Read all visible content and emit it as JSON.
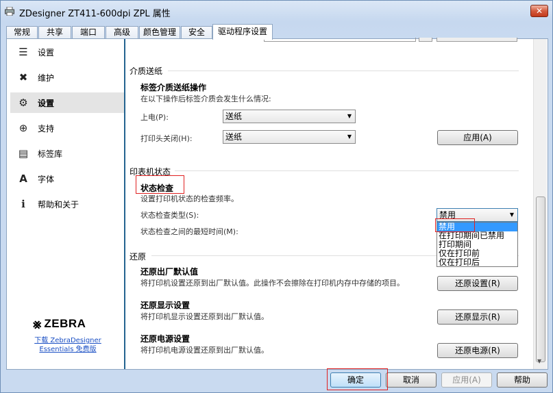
{
  "window": {
    "title": "ZDesigner ZT411-600dpi ZPL 属性",
    "close_glyph": "✕"
  },
  "tabs": [
    {
      "label": "常规"
    },
    {
      "label": "共享"
    },
    {
      "label": "端口"
    },
    {
      "label": "高级"
    },
    {
      "label": "颜色管理"
    },
    {
      "label": "安全"
    },
    {
      "label": "驱动程序设置"
    }
  ],
  "sidebar": {
    "items": [
      {
        "label": "设置",
        "icon": "sliders-icon",
        "glyph": "☰"
      },
      {
        "label": "维护",
        "icon": "tools-icon",
        "glyph": "✖"
      },
      {
        "label": "设置",
        "icon": "gear-icon",
        "glyph": "⚙"
      },
      {
        "label": "支持",
        "icon": "lifebuoy-icon",
        "glyph": "⊕"
      },
      {
        "label": "标签库",
        "icon": "label-icon",
        "glyph": "▤"
      },
      {
        "label": "字体",
        "icon": "font-icon",
        "glyph": "A"
      },
      {
        "label": "帮助和关于",
        "icon": "info-icon",
        "glyph": "ℹ"
      }
    ],
    "brand": {
      "logo_text": "ZEBRA",
      "logo_glyph": "⨳",
      "link_line1": "下载 ZebraDesigner",
      "link_line2": "Essentials 免费版"
    }
  },
  "media_feed": {
    "section_title": "介质送纸",
    "subtitle": "标签介质送纸操作",
    "description": "在以下操作后标签介质会发生什么情况:",
    "power_up_label": "上电(P):",
    "power_up_value": "送纸",
    "head_close_label": "打印头关闭(H):",
    "head_close_value": "送纸",
    "apply_button": "应用(A)"
  },
  "printer_status": {
    "section_title": "印表机状态",
    "subtitle": "状态检查",
    "description": "设置打印机状态的检查频率。",
    "check_type_label": "状态检查类型(S):",
    "check_type_value": "禁用",
    "min_time_label": "状态检查之间的最短时间(M):",
    "options": [
      "禁用",
      "在打印期间已禁用",
      "打印期间",
      "仅在打印前",
      "仅在打印后"
    ]
  },
  "restore": {
    "section_title": "还原",
    "defaults_title": "还原出厂默认值",
    "defaults_desc": "将打印机设置还原到出厂默认值。此操作不会擦除在打印机内存中存储的项目。",
    "defaults_button": "还原设置(R)",
    "display_title": "还原显示设置",
    "display_desc": "将打印机显示设置还原到出厂默认值。",
    "display_button": "还原显示(R)",
    "power_title": "还原电源设置",
    "power_desc": "将打印机电源设置还原到出厂默认值。",
    "power_button": "还原电源(R)"
  },
  "footer": {
    "ok": "确定",
    "cancel": "取消",
    "apply": "应用(A)",
    "help": "帮助"
  },
  "colors": {
    "sidebar_accent": "#23638f",
    "selection": "#3399ff",
    "highlight_box": "#e02020"
  }
}
